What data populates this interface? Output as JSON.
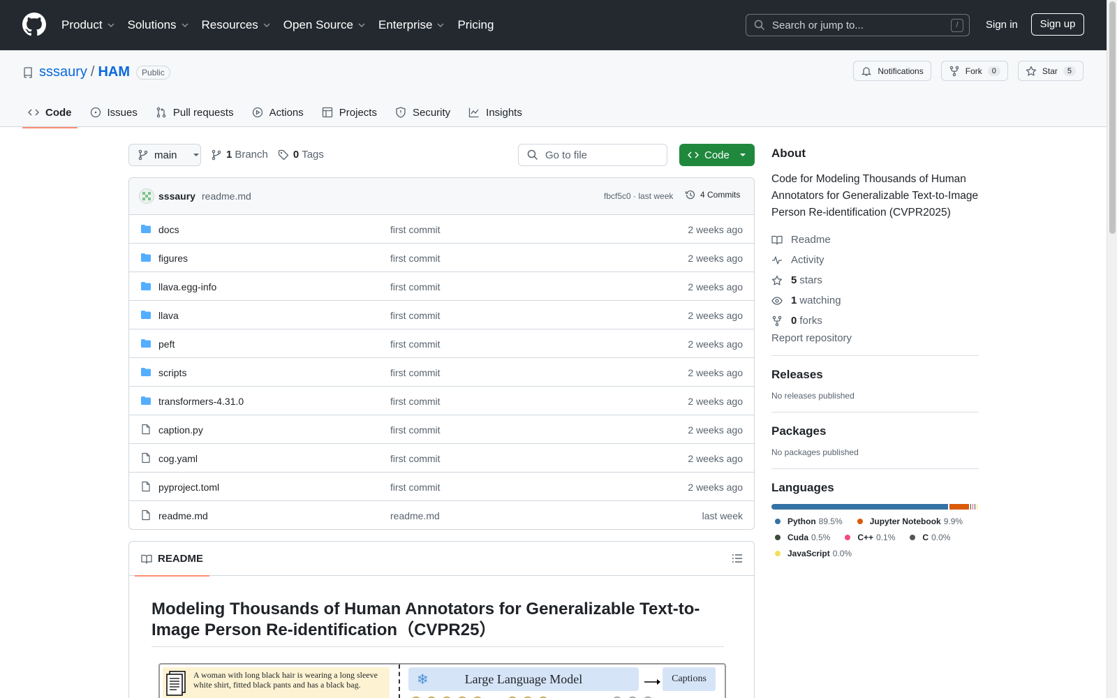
{
  "header": {
    "nav": [
      "Product",
      "Solutions",
      "Resources",
      "Open Source",
      "Enterprise",
      "Pricing"
    ],
    "search_placeholder": "Search or jump to...",
    "search_shortcut": "/",
    "signin": "Sign in",
    "signup": "Sign up"
  },
  "repo": {
    "owner": "sssaury",
    "separator": "/",
    "name": "HAM",
    "visibility": "Public",
    "notifications": "Notifications",
    "fork_label": "Fork",
    "fork_count": "0",
    "star_label": "Star",
    "star_count": "5",
    "tabs": [
      "Code",
      "Issues",
      "Pull requests",
      "Actions",
      "Projects",
      "Security",
      "Insights"
    ]
  },
  "branchbar": {
    "branch": "main",
    "branch_count": "1",
    "branch_label": "Branch",
    "tag_count": "0",
    "tag_label": "Tags",
    "goto_placeholder": "Go to file",
    "code_button": "Code"
  },
  "commit": {
    "user": "sssaury",
    "message": "readme.md",
    "meta": "fbcf5c0 · last week",
    "commits": "4 Commits"
  },
  "files": [
    {
      "type": "dir",
      "name": "docs",
      "message": "first commit",
      "age": "2 weeks ago"
    },
    {
      "type": "dir",
      "name": "figures",
      "message": "first commit",
      "age": "2 weeks ago"
    },
    {
      "type": "dir",
      "name": "llava.egg-info",
      "message": "first commit",
      "age": "2 weeks ago"
    },
    {
      "type": "dir",
      "name": "llava",
      "message": "first commit",
      "age": "2 weeks ago"
    },
    {
      "type": "dir",
      "name": "peft",
      "message": "first commit",
      "age": "2 weeks ago"
    },
    {
      "type": "dir",
      "name": "scripts",
      "message": "first commit",
      "age": "2 weeks ago"
    },
    {
      "type": "dir",
      "name": "transformers-4.31.0",
      "message": "first commit",
      "age": "2 weeks ago"
    },
    {
      "type": "file",
      "name": "caption.py",
      "message": "first commit",
      "age": "2 weeks ago"
    },
    {
      "type": "file",
      "name": "cog.yaml",
      "message": "first commit",
      "age": "2 weeks ago"
    },
    {
      "type": "file",
      "name": "pyproject.toml",
      "message": "first commit",
      "age": "2 weeks ago"
    },
    {
      "type": "file",
      "name": "readme.md",
      "message": "readme.md",
      "age": "last week"
    }
  ],
  "readme": {
    "tab": "README",
    "title": "Modeling Thousands of Human Annotators for Generalizable Text-to-Image Person Re-identification（CVPR25）",
    "figure": {
      "text": "A woman with long black hair is wearing a long sleeve white shirt, fitted black pants and has a black bag.",
      "llm": "Large Language Model",
      "captions": "Captions"
    }
  },
  "about": {
    "title": "About",
    "description": "Code for Modeling Thousands of Human Annotators for Generalizable Text-to-Image Person Re-identification (CVPR2025)",
    "readme": "Readme",
    "activity": "Activity",
    "stars_count": "5",
    "stars_label": "stars",
    "watching_count": "1",
    "watching_label": "watching",
    "forks_count": "0",
    "forks_label": "forks",
    "report": "Report repository"
  },
  "releases": {
    "title": "Releases",
    "text": "No releases published"
  },
  "packages": {
    "title": "Packages",
    "text": "No packages published"
  },
  "languages": {
    "title": "Languages",
    "items": [
      {
        "name": "Python",
        "percent": "89.5%",
        "value": 89.5,
        "color": "#3572A5"
      },
      {
        "name": "Jupyter Notebook",
        "percent": "9.9%",
        "value": 9.9,
        "color": "#DA5B0B"
      },
      {
        "name": "Cuda",
        "percent": "0.5%",
        "value": 0.5,
        "color": "#3A4E3A"
      },
      {
        "name": "C++",
        "percent": "0.1%",
        "value": 0.1,
        "color": "#f34b7d"
      },
      {
        "name": "C",
        "percent": "0.0%",
        "value": 0.0,
        "color": "#555555"
      },
      {
        "name": "JavaScript",
        "percent": "0.0%",
        "value": 0.0,
        "color": "#f1e05a"
      }
    ]
  }
}
